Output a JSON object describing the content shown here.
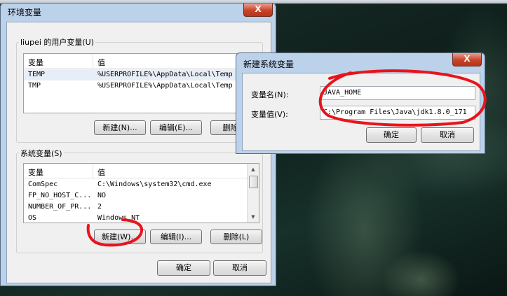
{
  "background": {
    "color": "#0e1c18"
  },
  "env_dialog": {
    "title": "环境变量",
    "close_glyph": "X",
    "user_vars": {
      "group_label": "liupei 的用户变量(U)",
      "col_var": "变量",
      "col_val": "值",
      "rows": [
        {
          "name": "TEMP",
          "value": "%USERPROFILE%\\AppData\\Local\\Temp"
        },
        {
          "name": "TMP",
          "value": "%USERPROFILE%\\AppData\\Local\\Temp"
        }
      ],
      "new_button": "新建(N)...",
      "edit_button": "编辑(E)...",
      "delete_button": "删除(D)"
    },
    "sys_vars": {
      "group_label": "系统变量(S)",
      "col_var": "变量",
      "col_val": "值",
      "rows": [
        {
          "name": "ComSpec",
          "value": "C:\\Windows\\system32\\cmd.exe"
        },
        {
          "name": "FP_NO_HOST_C...",
          "value": "NO"
        },
        {
          "name": "NUMBER_OF_PR...",
          "value": "2"
        },
        {
          "name": "OS",
          "value": "Windows_NT"
        }
      ],
      "new_button": "新建(W)...",
      "edit_button": "编辑(I)...",
      "delete_button": "删除(L)"
    },
    "ok_button": "确定",
    "cancel_button": "取消"
  },
  "new_var_dialog": {
    "title": "新建系统变量",
    "close_glyph": "X",
    "name_label": "变量名(N):",
    "name_value": "JAVA_HOME",
    "value_label": "变量值(V):",
    "value_value": "C:\\Program Files\\Java\\jdk1.8.0_171",
    "ok_button": "确定",
    "cancel_button": "取消"
  },
  "annotation_color": "#e8141c"
}
